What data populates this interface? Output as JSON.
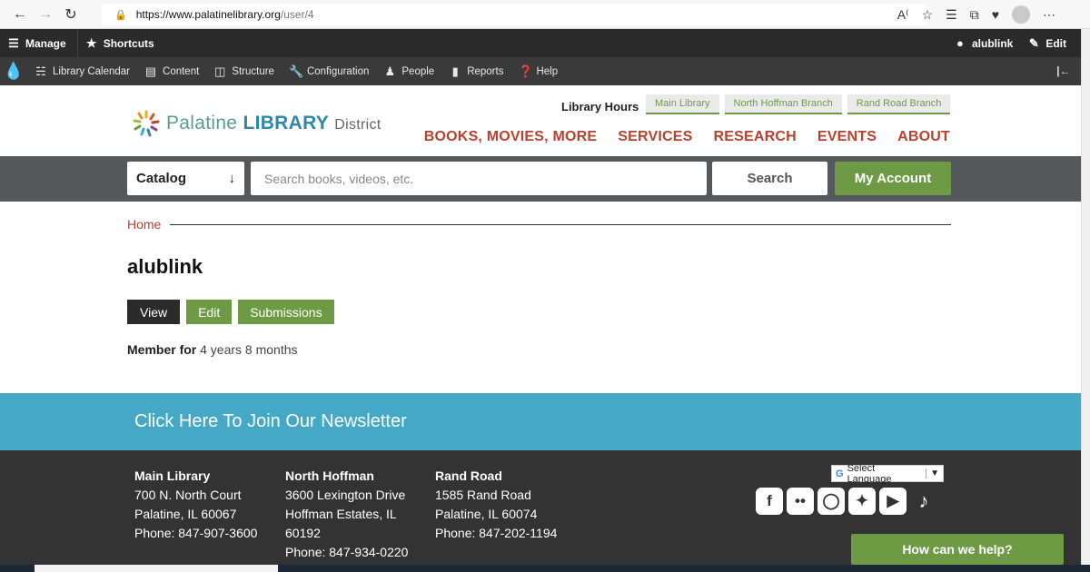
{
  "browser": {
    "url_domain": "https://www.palatinelibrary.org",
    "url_path": "/user/4",
    "reader_icon": "read-aloud-icon"
  },
  "admin": {
    "manage": "Manage",
    "shortcuts": "Shortcuts",
    "user": "alublink",
    "edit": "Edit",
    "menu": [
      {
        "label": "Library Calendar",
        "icon": "calendar-icon"
      },
      {
        "label": "Content",
        "icon": "file-icon"
      },
      {
        "label": "Structure",
        "icon": "structure-icon"
      },
      {
        "label": "Configuration",
        "icon": "wrench-icon"
      },
      {
        "label": "People",
        "icon": "people-icon"
      },
      {
        "label": "Reports",
        "icon": "bar-chart-icon"
      },
      {
        "label": "Help",
        "icon": "help-icon"
      }
    ]
  },
  "header": {
    "logo_word1": "Palatine",
    "logo_word2": "LIBRARY",
    "logo_word3": "District",
    "hours_label": "Library Hours",
    "branches": [
      "Main Library",
      "North Hoffman Branch",
      "Rand Road Branch"
    ],
    "nav": [
      "BOOKS, MOVIES, MORE",
      "SERVICES",
      "RESEARCH",
      "EVENTS",
      "ABOUT"
    ]
  },
  "search": {
    "catalog_label": "Catalog",
    "placeholder": "Search books, videos, etc.",
    "search_button": "Search",
    "account_button": "My Account"
  },
  "main": {
    "breadcrumb": "Home",
    "title": "alublink",
    "tabs": [
      "View",
      "Edit",
      "Submissions"
    ],
    "member_label": "Member for",
    "member_value": "4 years 8 months"
  },
  "newsletter": "Click Here To Join Our Newsletter",
  "footer": {
    "branches": [
      {
        "name": "Main Library",
        "lines": [
          "700 N. North Court",
          "Palatine, IL 60067",
          "Phone: 847-907-3600"
        ]
      },
      {
        "name": "North Hoffman",
        "lines": [
          "3600 Lexington Drive",
          "Hoffman Estates, IL",
          "60192",
          "Phone: 847-934-0220"
        ]
      },
      {
        "name": "Rand Road",
        "lines": [
          "1585 Rand Road",
          "Palatine, IL 60074",
          "Phone: 847-202-1194"
        ]
      }
    ],
    "language": "Select Language",
    "social": [
      "facebook-icon",
      "flickr-icon",
      "instagram-icon",
      "twitter-icon",
      "youtube-icon",
      "tiktok-icon"
    ]
  },
  "help_button": "How can we help?",
  "colors": {
    "accent_green": "#6e9a46",
    "brand_red": "#b8412f",
    "newsletter_blue": "#45a9c6",
    "admin_dark": "#2b2b2b"
  }
}
